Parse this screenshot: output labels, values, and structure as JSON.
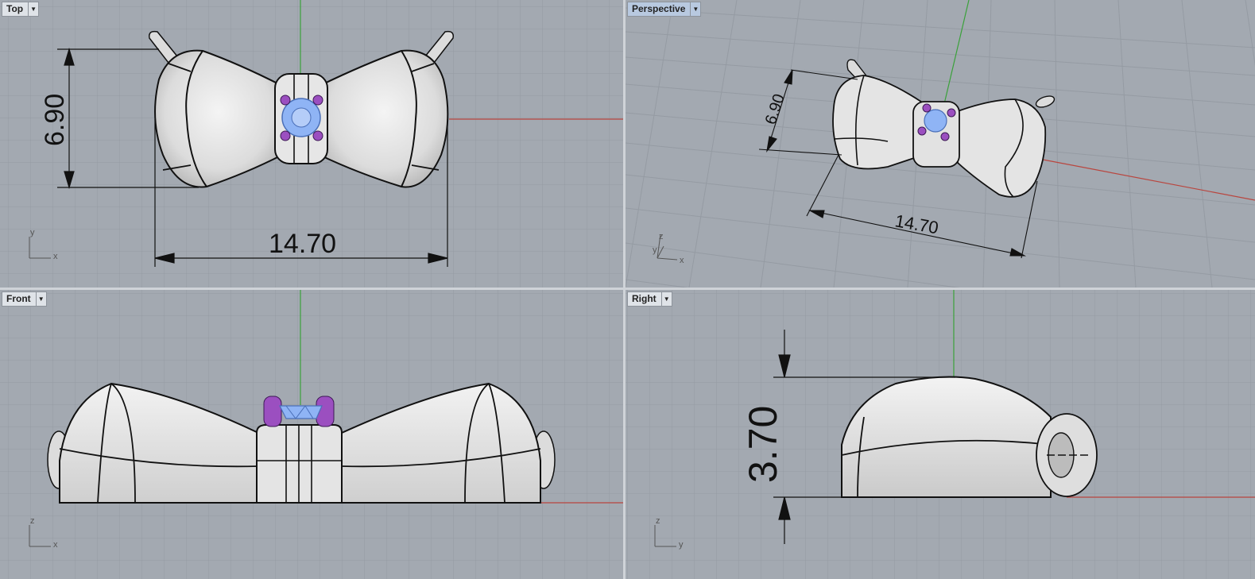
{
  "viewports": {
    "top": {
      "title": "Top",
      "menu_icon": "dropdown-arrow-icon",
      "dimensions": [
        "14.70",
        "6.90"
      ],
      "axes": [
        "y",
        "x"
      ]
    },
    "perspective": {
      "title": "Perspective",
      "menu_icon": "dropdown-arrow-icon",
      "dimensions": [
        "14.70",
        "6.90"
      ],
      "axes": [
        "z",
        "y",
        "x"
      ]
    },
    "front": {
      "title": "Front",
      "menu_icon": "dropdown-arrow-icon",
      "axes": [
        "z",
        "x"
      ]
    },
    "right": {
      "title": "Right",
      "menu_icon": "dropdown-arrow-icon",
      "dimensions": [
        "3.70"
      ],
      "axes": [
        "z",
        "y"
      ]
    }
  },
  "colors": {
    "viewport_bg": "#a3a9b1",
    "grid": "#959ba3",
    "x_axis": "#b9463f",
    "y_axis": "#3aa13a",
    "gem": "#8fb4f5",
    "prong": "#9b4fc0",
    "body": "#e8e8e8"
  }
}
